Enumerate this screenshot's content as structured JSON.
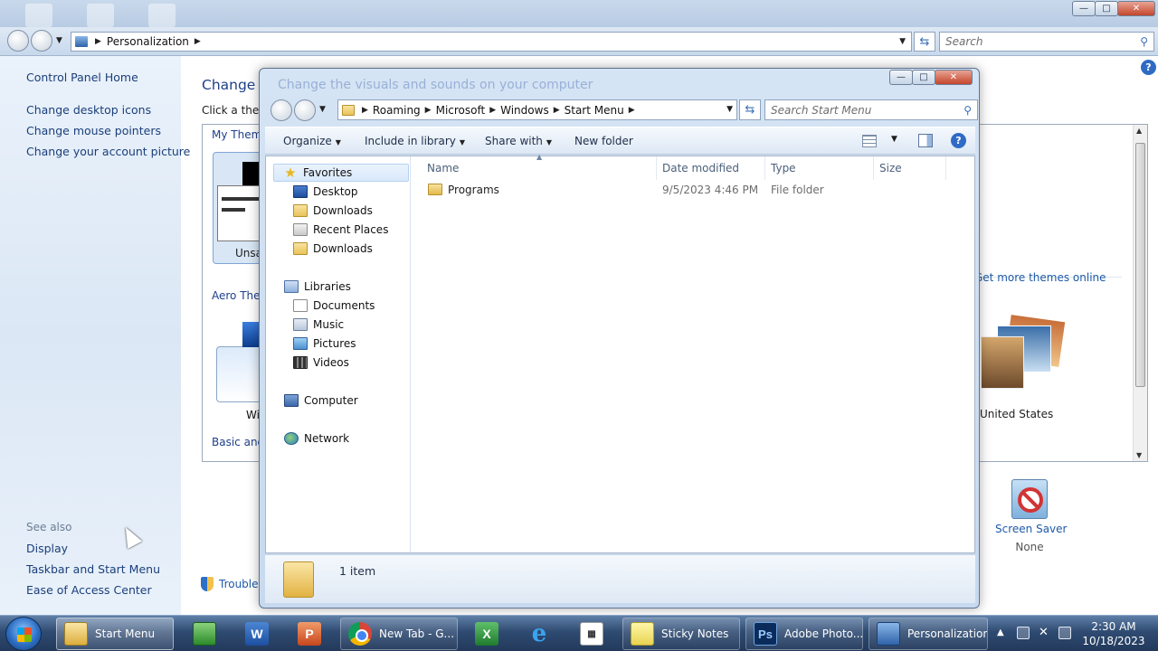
{
  "background_window": {
    "breadcrumb": "Personalization",
    "search_placeholder": "Search",
    "sidebar": {
      "home": "Control Panel Home",
      "links": [
        "Change desktop icons",
        "Change mouse pointers",
        "Change your account picture"
      ],
      "see_also_heading": "See also",
      "see_also": [
        "Display",
        "Taskbar and Start Menu",
        "Ease of Access Center"
      ]
    },
    "main": {
      "title_visible": "Change t",
      "subtitle_visible": "Click a them",
      "groups": {
        "my_themes": "My Theme",
        "aero_themes": "Aero Them",
        "basic": "Basic and H"
      },
      "unsaved_label": "Unsa",
      "win_label": "Win",
      "get_more_themes": "Get more themes online",
      "united_states": "United States",
      "screen_saver": {
        "label": "Screen Saver",
        "value": "None"
      },
      "troubleshoot_visible": "Trouble"
    },
    "help": "?"
  },
  "explorer": {
    "ghost_title": "Change the visuals and sounds on your computer",
    "address": [
      "Roaming",
      "Microsoft",
      "Windows",
      "Start Menu"
    ],
    "search_placeholder": "Search Start Menu",
    "toolbar": {
      "organize": "Organize",
      "include_in_library": "Include in library",
      "share_with": "Share with",
      "new_folder": "New folder",
      "help": "?"
    },
    "nav": {
      "favorites": "Favorites",
      "favorites_items": [
        "Desktop",
        "Downloads",
        "Recent Places",
        "Downloads"
      ],
      "libraries": "Libraries",
      "libraries_items": [
        "Documents",
        "Music",
        "Pictures",
        "Videos"
      ],
      "computer": "Computer",
      "network": "Network"
    },
    "columns": [
      "Name",
      "Date modified",
      "Type",
      "Size"
    ],
    "rows": [
      {
        "name": "Programs",
        "date": "9/5/2023 4:46 PM",
        "type": "File folder",
        "size": ""
      }
    ],
    "details": {
      "count": "1 item"
    }
  },
  "taskbar": {
    "buttons": {
      "start_menu": "Start Menu",
      "chrome": "New Tab - G...",
      "sticky": "Sticky Notes",
      "photoshop": "Adobe Photo...",
      "personalization": "Personalization"
    },
    "app_glyphs": {
      "word": "W",
      "ppt": "P",
      "excel": "X",
      "ie": "e",
      "ps": "Ps"
    },
    "clock": {
      "time": "2:30 AM",
      "date": "10/18/2023"
    }
  }
}
